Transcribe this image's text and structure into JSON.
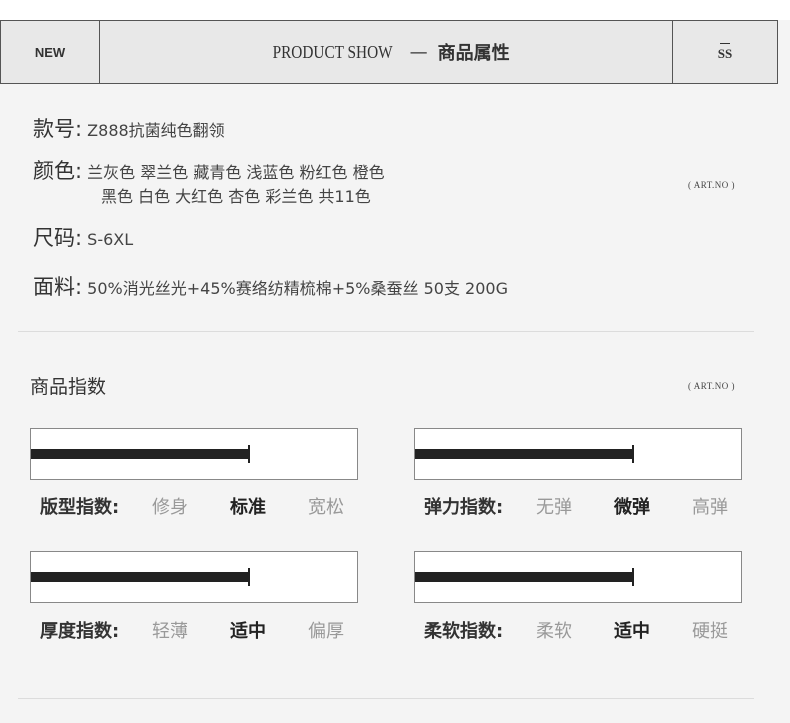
{
  "header": {
    "left": "NEW",
    "title_en": "PRODUCT SHOW",
    "separator": "—",
    "title_cn": "商品属性",
    "right": "SS"
  },
  "info": {
    "model_label": "款号:",
    "model_value": "Z888抗菌纯色翻领",
    "color_label": "颜色:",
    "color_line1": "兰灰色 翠兰色 藏青色 浅蓝色 粉红色 橙色",
    "color_line2": "黑色 白色 大红色 杏色 彩兰色 共11色",
    "size_label": "尺码:",
    "size_value": "S-6XL",
    "fabric_label": "面料:",
    "fabric_value": "50%消光丝光+45%赛络纺精梳棉+5%桑蚕丝  50支  200G",
    "art_no": "( ART.NO  )"
  },
  "index": {
    "title": "商品指数",
    "art_no": "( ART.NO  )",
    "meters": [
      {
        "label": "版型指数:",
        "options": [
          "修身",
          "标准",
          "宽松"
        ],
        "selected": 1,
        "level": 0.67
      },
      {
        "label": "弹力指数:",
        "options": [
          "无弹",
          "微弹",
          "高弹"
        ],
        "selected": 1,
        "level": 0.67
      },
      {
        "label": "厚度指数:",
        "options": [
          "轻薄",
          "适中",
          "偏厚"
        ],
        "selected": 1,
        "level": 0.67
      },
      {
        "label": "柔软指数:",
        "options": [
          "柔软",
          "适中",
          "硬挺"
        ],
        "selected": 1,
        "level": 0.67
      }
    ]
  }
}
